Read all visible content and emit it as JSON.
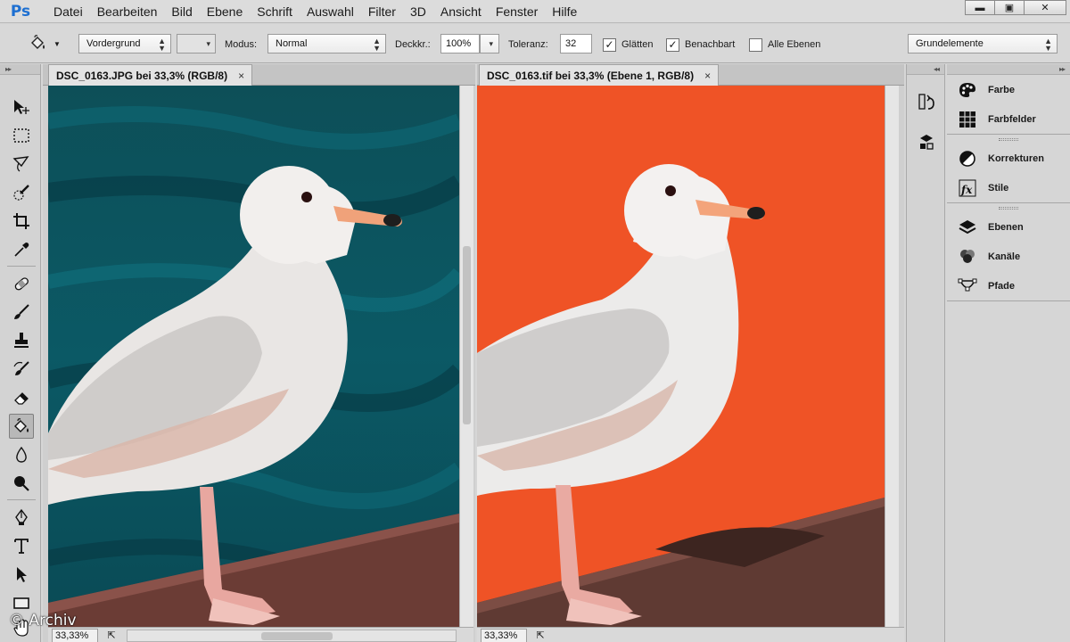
{
  "app": {
    "logo": "Ps"
  },
  "menu": [
    "Datei",
    "Bearbeiten",
    "Bild",
    "Ebene",
    "Schrift",
    "Auswahl",
    "Filter",
    "3D",
    "Ansicht",
    "Fenster",
    "Hilfe"
  ],
  "window_controls": {
    "minimize": "▬",
    "restore": "▣",
    "close": "✕"
  },
  "options": {
    "fill_source": "Vordergrund",
    "mode_label": "Modus:",
    "mode_value": "Normal",
    "opacity_label": "Deckkr.:",
    "opacity_value": "100%",
    "tolerance_label": "Toleranz:",
    "tolerance_value": "32",
    "smooth_label": "Glätten",
    "smooth_checked": true,
    "contiguous_label": "Benachbart",
    "contiguous_checked": true,
    "all_layers_label": "Alle Ebenen",
    "all_layers_checked": false,
    "workspace": "Grundelemente"
  },
  "documents": [
    {
      "title": "DSC_0163.JPG bei 33,3% (RGB/8)",
      "close": "×",
      "zoom": "33,33%",
      "background": "teal-water"
    },
    {
      "title": "DSC_0163.tif bei 33,3% (Ebene 1, RGB/8)",
      "close": "×",
      "zoom": "33,33%",
      "background": "#ef5326"
    }
  ],
  "tools": [
    "move-icon",
    "marquee-icon",
    "lasso-icon",
    "quick-select-icon",
    "crop-icon",
    "eyedropper-icon",
    "healing-brush-icon",
    "brush-icon",
    "stamp-icon",
    "history-brush-icon",
    "eraser-icon",
    "paint-bucket-icon",
    "blur-icon",
    "dodge-icon",
    "pen-icon",
    "type-icon",
    "path-select-icon",
    "rectangle-icon",
    "hand-icon"
  ],
  "panels": {
    "group1": [
      "Farbe",
      "Farbfelder"
    ],
    "group2": [
      "Korrekturen",
      "Stile"
    ],
    "group3": [
      "Ebenen",
      "Kanäle",
      "Pfade"
    ]
  },
  "watermark": "© Archiv",
  "colors": {
    "orange_bg": "#ef5326",
    "teal_bg": "#0d5360",
    "logo_blue": "#1d6fd1"
  }
}
